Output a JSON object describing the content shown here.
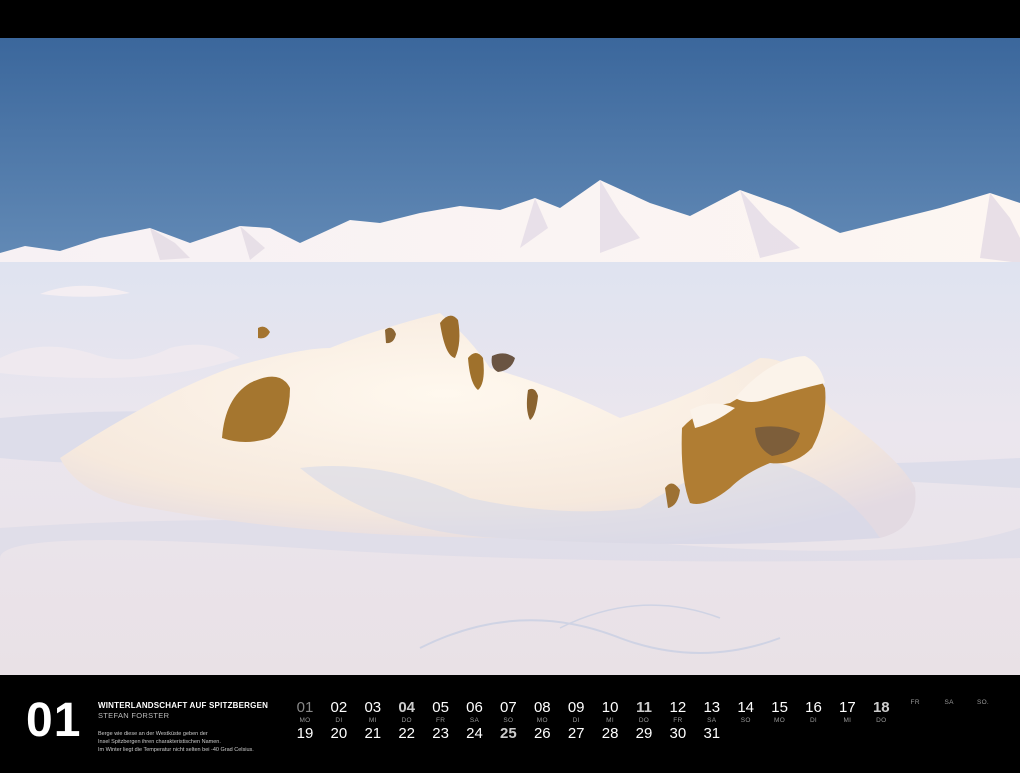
{
  "calendar": {
    "month_number": "01",
    "title": "WINTERLANDSCHAFT AUF SPITZBERGEN",
    "author": "STEFAN FORSTER",
    "description": [
      "Berge wie diese an der Westküste geben der",
      "Insel Spitzbergen ihren charakteristischen Namen.",
      "Im Winter liegt die Temperatur nicht selten bei -40 Grad Celsius."
    ],
    "columns": [
      {
        "top": "01",
        "label": "MO",
        "bottom": "19",
        "top_style": "muted",
        "bottom_style": ""
      },
      {
        "top": "02",
        "label": "DI",
        "bottom": "20",
        "top_style": "",
        "bottom_style": ""
      },
      {
        "top": "03",
        "label": "MI",
        "bottom": "21",
        "top_style": "",
        "bottom_style": ""
      },
      {
        "top": "04",
        "label": "DO",
        "bottom": "22",
        "top_style": "bold",
        "bottom_style": ""
      },
      {
        "top": "05",
        "label": "FR",
        "bottom": "23",
        "top_style": "",
        "bottom_style": ""
      },
      {
        "top": "06",
        "label": "SA",
        "bottom": "24",
        "top_style": "",
        "bottom_style": ""
      },
      {
        "top": "07",
        "label": "SO",
        "bottom": "25",
        "top_style": "",
        "bottom_style": "bold"
      },
      {
        "top": "08",
        "label": "MO",
        "bottom": "26",
        "top_style": "",
        "bottom_style": ""
      },
      {
        "top": "09",
        "label": "DI",
        "bottom": "27",
        "top_style": "",
        "bottom_style": ""
      },
      {
        "top": "10",
        "label": "MI",
        "bottom": "28",
        "top_style": "",
        "bottom_style": ""
      },
      {
        "top": "11",
        "label": "DO",
        "bottom": "29",
        "top_style": "bold",
        "bottom_style": ""
      },
      {
        "top": "12",
        "label": "FR",
        "bottom": "30",
        "top_style": "",
        "bottom_style": ""
      },
      {
        "top": "13",
        "label": "SA",
        "bottom": "31",
        "top_style": "",
        "bottom_style": ""
      },
      {
        "top": "14",
        "label": "SO",
        "bottom": "",
        "top_style": "",
        "bottom_style": ""
      },
      {
        "top": "15",
        "label": "MO",
        "bottom": "",
        "top_style": "",
        "bottom_style": ""
      },
      {
        "top": "16",
        "label": "DI",
        "bottom": "",
        "top_style": "",
        "bottom_style": ""
      },
      {
        "top": "17",
        "label": "MI",
        "bottom": "",
        "top_style": "",
        "bottom_style": ""
      },
      {
        "top": "18",
        "label": "DO",
        "bottom": "",
        "top_style": "bold",
        "bottom_style": ""
      },
      {
        "top": "",
        "label": "FR",
        "bottom": "",
        "top_style": "",
        "bottom_style": ""
      },
      {
        "top": "",
        "label": "SA",
        "bottom": "",
        "top_style": "",
        "bottom_style": ""
      },
      {
        "top": "",
        "label": "SO.",
        "bottom": "",
        "top_style": "",
        "bottom_style": ""
      }
    ]
  },
  "colors": {
    "sky_top": "#3f6a9e",
    "sky_bottom": "#9cbbd6",
    "snow_light": "#fbf3ec",
    "snow_shadow": "#b9c6df",
    "rock": "#a9772e",
    "footer_bg": "#000000"
  }
}
